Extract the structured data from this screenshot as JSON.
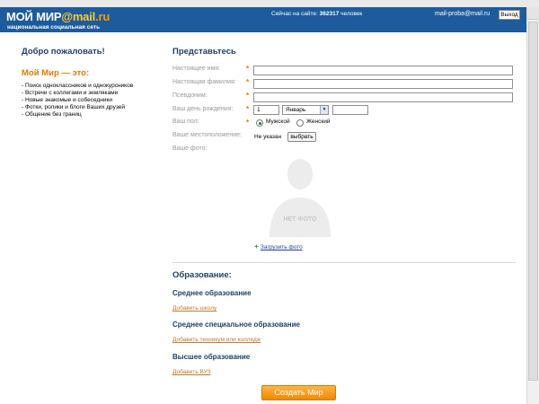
{
  "header": {
    "logo_text": "МОЙ МИР",
    "logo_mail": "@mail",
    "logo_ru": ".ru",
    "tagline": "национальная социальная сеть",
    "online_prefix": "Сейчас на сайте:",
    "online_count": "362317",
    "online_suffix": "человек",
    "user_email": "mail-proba@mail.ru",
    "logout_label": "Выход"
  },
  "left": {
    "welcome": "Добро пожаловать!",
    "mir_heading": "Мой Мир — это:",
    "features": [
      "- Поиск одноклассников и однокурсников",
      "- Встречи с коллегами и земляками",
      "- Новые знакомые и собеседники",
      "- Фотки, ролики и блоги Ваших друзей",
      "- Общение без границ"
    ]
  },
  "form": {
    "title": "Представьтесь",
    "required_mark": "*",
    "labels": {
      "real_name": "Настоящее имя:",
      "real_surname": "Настоящая фамилия:",
      "nickname": "Псевдоним:",
      "birthday": "Ваш день рождения:",
      "gender": "Ваш пол:",
      "location": "Ваше местоположение:",
      "photo": "Ваше фото:"
    },
    "birthday_day": "1",
    "birthday_month": "Январь",
    "gender_male": "Мужской",
    "gender_female": "Женский",
    "gender_selected": "male",
    "location_value": "Не указан",
    "choose_label": "выбрать",
    "no_photo_text": "НЕТ ФОТО",
    "upload_photo_label": "Загрузить фото"
  },
  "education": {
    "title": "Образование:",
    "secondary_title": "Среднее образование",
    "secondary_link": "Добавить школу",
    "vocational_title": "Среднее специальное образование",
    "vocational_link": "Добавить техникум или колледж",
    "higher_title": "Высшее образование",
    "higher_link": "Добавить ВУЗ"
  },
  "submit_label": "Создать Мир",
  "colors": {
    "header_bg": "#1d5b9c",
    "accent_orange": "#e07a00",
    "heading_blue": "#1f3f66"
  }
}
